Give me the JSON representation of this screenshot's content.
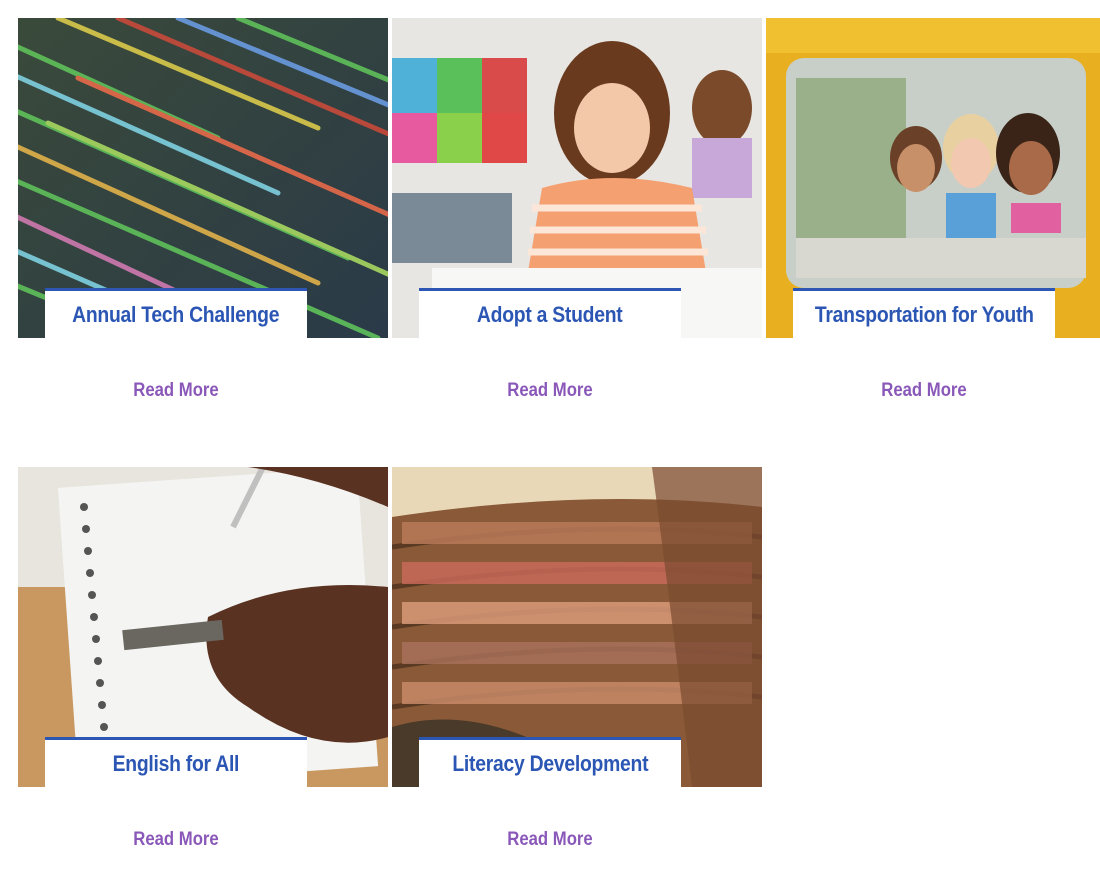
{
  "cards": [
    {
      "title": "Annual Tech Challenge",
      "link_label": "Read More",
      "image_icon": "code-screen-image"
    },
    {
      "title": "Adopt a Student",
      "link_label": "Read More",
      "image_icon": "girl-writing-image"
    },
    {
      "title": "Transportation for Youth",
      "link_label": "Read More",
      "image_icon": "kids-in-bus-image"
    },
    {
      "title": "English for All",
      "link_label": "Read More",
      "image_icon": "hand-writing-notebook-image"
    },
    {
      "title": "Literacy Development",
      "link_label": "Read More",
      "image_icon": "library-shelves-image"
    }
  ],
  "colors": {
    "title": "#2b56b4",
    "title_border": "#2b56b4",
    "link": "#8a58b8"
  }
}
